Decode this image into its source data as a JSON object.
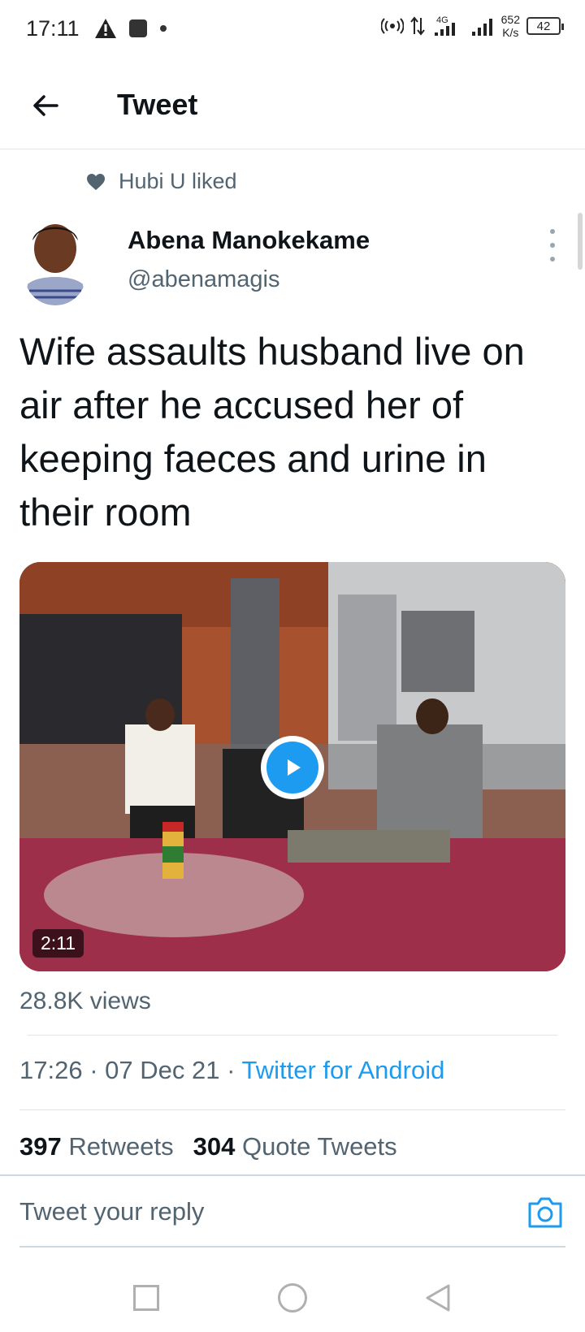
{
  "status_bar": {
    "time": "17:11",
    "icons": [
      "warning-icon",
      "square-notification-icon",
      "dot-icon",
      "hotspot-icon",
      "data-transfer-icon",
      "signal-4g-icon",
      "signal-icon"
    ],
    "network": "4G",
    "speed_value": "652",
    "speed_unit": "K/s",
    "battery": "42"
  },
  "header": {
    "title": "Tweet",
    "back_icon": "back-arrow-icon"
  },
  "social_context": {
    "icon": "heart-icon",
    "text": "Hubi U liked"
  },
  "tweet": {
    "author_name": "Abena Manokekame",
    "author_handle": "@abenamagis",
    "text": "Wife assaults husband live on air after he accused her of keeping faeces and urine in their room",
    "media": {
      "type": "video",
      "duration": "2:11",
      "play_icon": "play-icon"
    },
    "views": "28.8K views",
    "time": "17:26",
    "date": "07 Dec 21",
    "source": "Twitter for Android",
    "retweets_count": "397",
    "retweets_label": "Retweets",
    "quotes_count": "304",
    "quotes_label": "Quote Tweets"
  },
  "reply": {
    "placeholder": "Tweet your reply",
    "camera_icon": "camera-icon"
  },
  "nav": {
    "icons": [
      "recent-apps-icon",
      "home-icon",
      "back-icon"
    ]
  },
  "colors": {
    "accent": "#1d9bf0",
    "text_primary": "#0f1419",
    "text_secondary": "#536471"
  }
}
